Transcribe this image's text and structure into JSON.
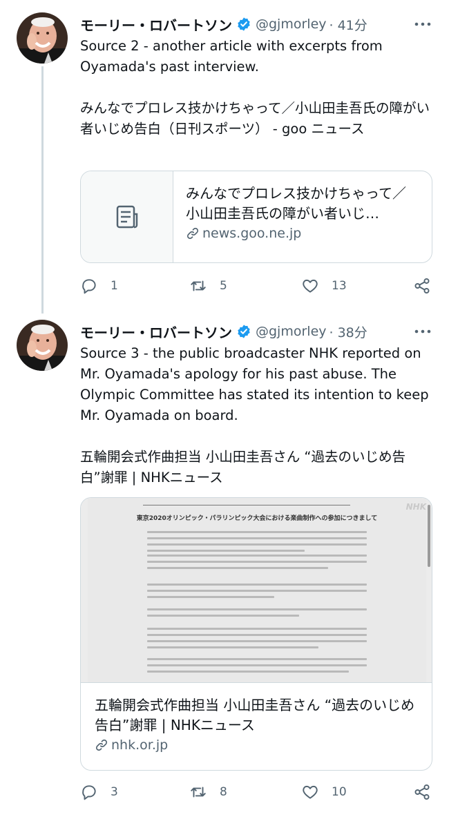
{
  "tweets": [
    {
      "author": {
        "display_name": "モーリー・ロバートソン",
        "handle": "@gjmorley",
        "time": "· 41分"
      },
      "text_line1": "Source 2 - another article with excerpts from Oyamada's past interview.",
      "text_line2": "みんなでプロレス技かけちゃって／小山田圭吾氏の障がい者いじめ告白（日刊スポーツ） - goo ニュース",
      "card": {
        "title": "みんなでプロレス技かけちゃって／小山田圭吾氏の障がい者いじ…",
        "domain": "news.goo.ne.jp"
      },
      "stats": {
        "replies": "1",
        "retweets": "5",
        "likes": "13"
      }
    },
    {
      "author": {
        "display_name": "モーリー・ロバートソン",
        "handle": "@gjmorley",
        "time": "· 38分"
      },
      "text_line1": "Source 3 - the public broadcaster NHK reported on Mr. Oyamada's apology for his past abuse.  The Olympic Committee has stated its intention to keep Mr. Oyamada on board.",
      "text_line2": "五輪開会式作曲担当 小山田圭吾さん “過去のいじめ告白”謝罪 | NHKニュース",
      "card": {
        "preview_heading": "東京2020オリンピック・パラリンピック大会における楽曲制作への参加につきまして",
        "preview_logo": "NHK",
        "title": "五輪開会式作曲担当 小山田圭吾さん “過去のいじめ告白”謝罪 | NHKニュース",
        "domain": "nhk.or.jp"
      },
      "stats": {
        "replies": "3",
        "retweets": "8",
        "likes": "10"
      }
    }
  ],
  "icons": {
    "verified": "verified-badge-icon",
    "more": "more-options-icon",
    "reply": "reply-icon",
    "retweet": "retweet-icon",
    "like": "heart-icon",
    "share": "share-icon",
    "link": "link-icon",
    "article": "article-icon"
  },
  "colors": {
    "verified": "#1d9bf0",
    "secondary_text": "#536471",
    "border": "#cfd9de",
    "primary_text": "#0f1419"
  }
}
